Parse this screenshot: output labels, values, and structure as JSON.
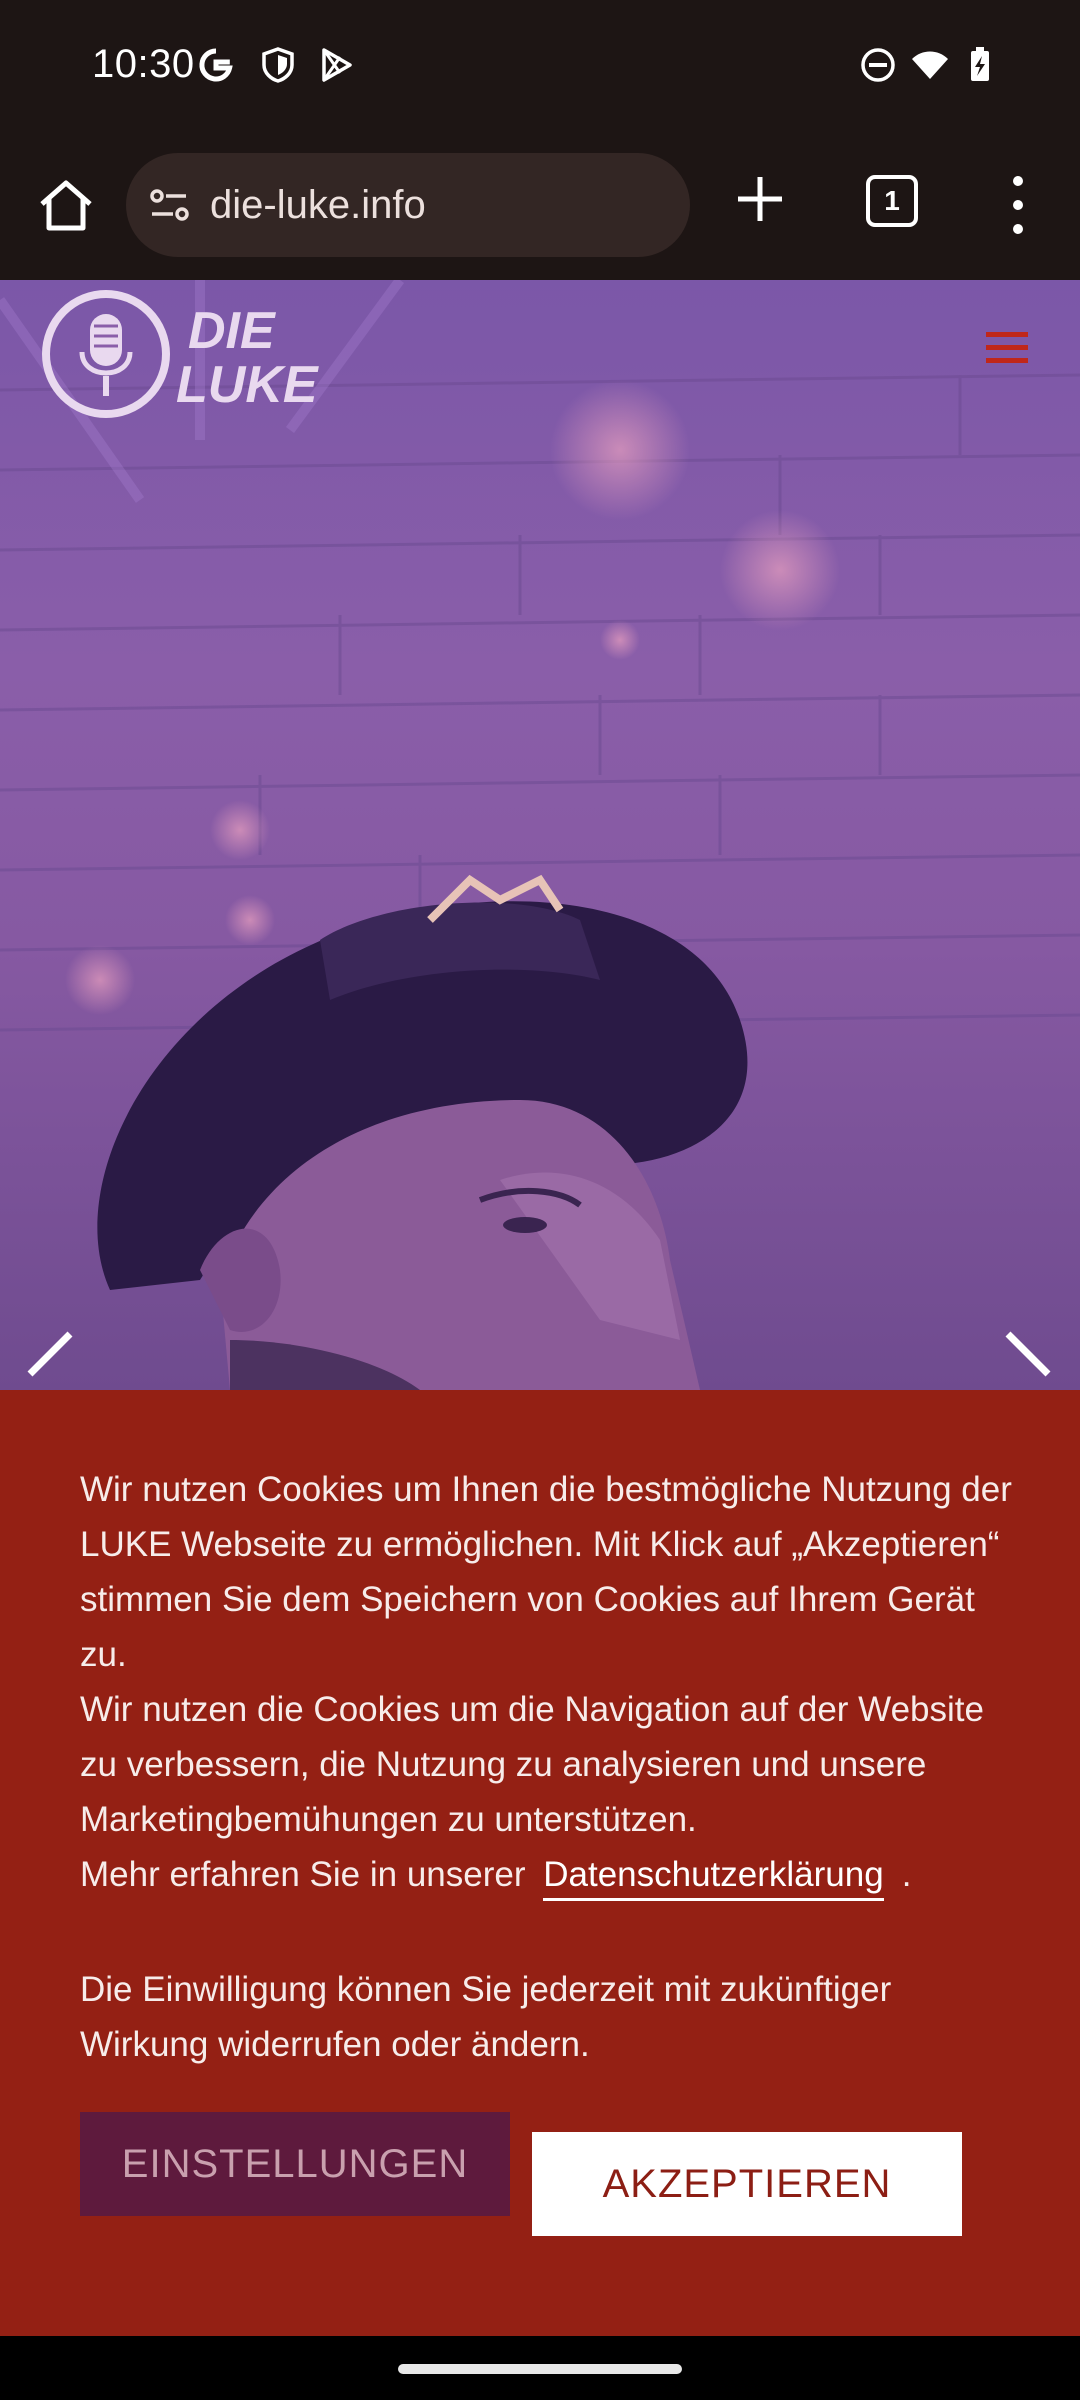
{
  "status_bar": {
    "time": "10:30",
    "left_icons": [
      "google-icon",
      "shield-icon",
      "play-store-icon"
    ],
    "right_icons": [
      "do-not-disturb-icon",
      "wifi-icon",
      "battery-charging-icon"
    ]
  },
  "browser": {
    "url": "die-luke.info",
    "tab_count": "1",
    "icons": [
      "home-icon",
      "site-info-icon",
      "plus-icon",
      "more-vert-icon"
    ]
  },
  "site": {
    "logo_line1": "DIE",
    "logo_line2": "LUKE",
    "menu_icon": "hamburger-icon",
    "accent_color": "#c0271a"
  },
  "cookie_banner": {
    "paragraph1": "Wir nutzen Cookies um Ihnen die bestmögliche Nutzung der LUKE Webseite zu ermöglichen. Mit Klick auf „Akzeptieren“ stimmen Sie dem Speichern von Cookies auf Ihrem Gerät zu.",
    "paragraph2": "Wir nutzen die Cookies um die Navigation auf der Website zu verbessern, die Nutzung zu analysieren und unsere Marketingbemühungen zu unterstützen.",
    "more_prefix": "Mehr erfahren Sie in unserer",
    "policy_link": "Datenschutzerklärung",
    "more_suffix": ".",
    "paragraph3": "Die Einwilligung können Sie jederzeit mit zukünftiger Wirkung widerrufen oder ändern.",
    "settings_button": "EINSTELLUNGEN",
    "accept_button": "AKZEPTIEREN",
    "background_color": "#942014"
  }
}
